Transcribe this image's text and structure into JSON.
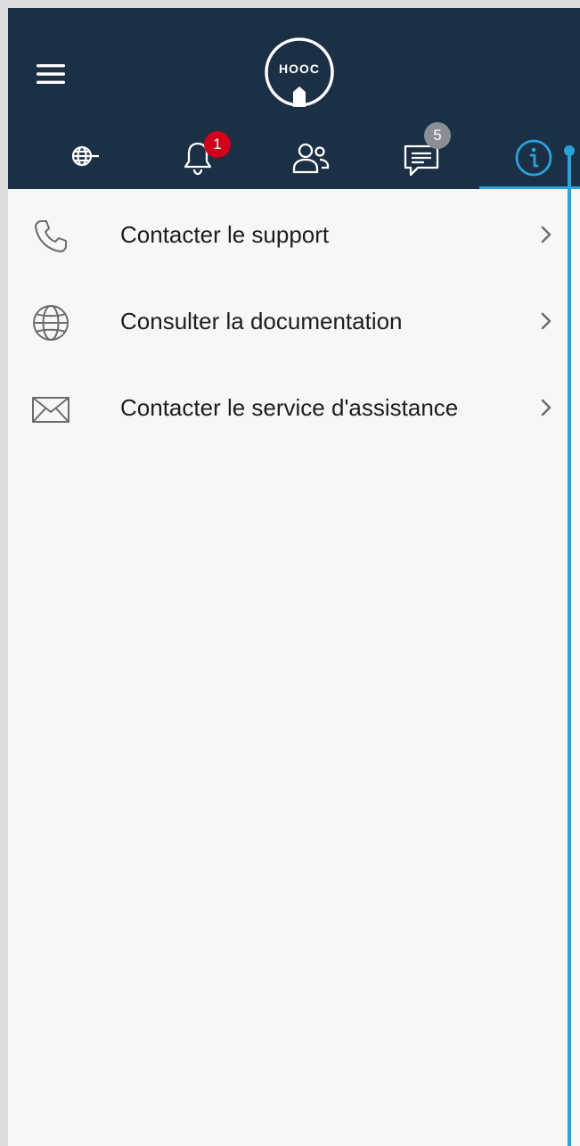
{
  "header": {
    "logo_text": "HOOC",
    "menu_icon": "hamburger-menu-icon",
    "background": "#1b2f45"
  },
  "tabs": [
    {
      "name": "network",
      "icon": "globe-plug-icon",
      "badge": null,
      "active": false
    },
    {
      "name": "notifications",
      "icon": "bell-icon",
      "badge": "1",
      "badge_color": "#d0021b",
      "active": false
    },
    {
      "name": "contacts",
      "icon": "users-icon",
      "badge": null,
      "active": false
    },
    {
      "name": "messages",
      "icon": "chat-icon",
      "badge": "5",
      "badge_color": "#8a8f96",
      "active": false
    },
    {
      "name": "info",
      "icon": "info-icon",
      "badge": null,
      "active": true
    }
  ],
  "accent_color": "#29a3dc",
  "menu": {
    "items": [
      {
        "label": "Contacter le support",
        "icon": "phone-icon"
      },
      {
        "label": "Consulter la documentation",
        "icon": "globe-icon"
      },
      {
        "label": "Contacter le service d'assistance",
        "icon": "envelope-icon"
      }
    ]
  }
}
